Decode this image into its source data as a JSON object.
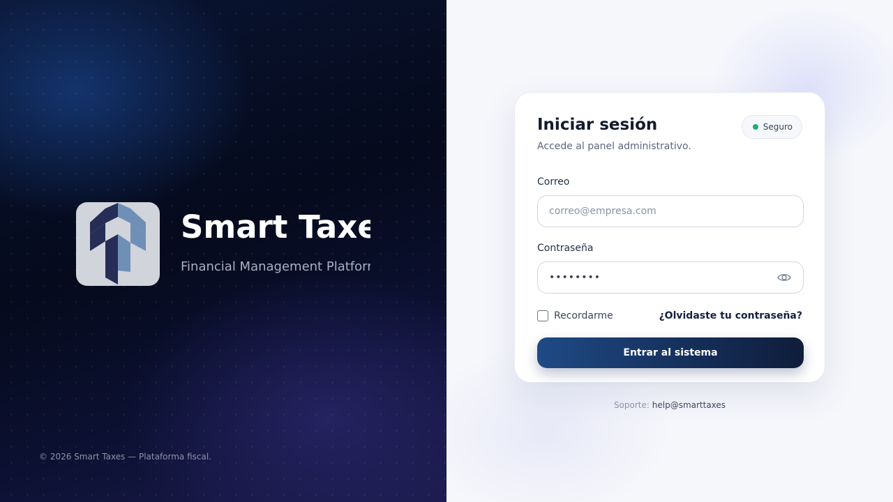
{
  "brand": {
    "title": "Smart Taxe",
    "subtitle": "Financial Management Platforr",
    "logo_icon": "smart-taxes-s-logo",
    "copyright": "© 2026 Smart Taxes — Plataforma fiscal."
  },
  "login": {
    "title": "Iniciar sesión",
    "subtitle": "Accede al panel administrativo.",
    "badge": "Seguro",
    "badge_color": "#19b274",
    "email_label": "Correo",
    "email_placeholder": "correo@empresa.com",
    "email_value": "",
    "password_label": "Contraseña",
    "password_value": "••••••••",
    "password_toggle_icon": "eye-icon",
    "remember_label": "Recordarme",
    "remember_checked": false,
    "forgot_link": "¿Olvidaste tu contraseña?",
    "submit_label": "Entrar al sistema",
    "accent_color": "#163260"
  },
  "support": {
    "label": "Soporte:",
    "email": "help@smarttaxes"
  }
}
